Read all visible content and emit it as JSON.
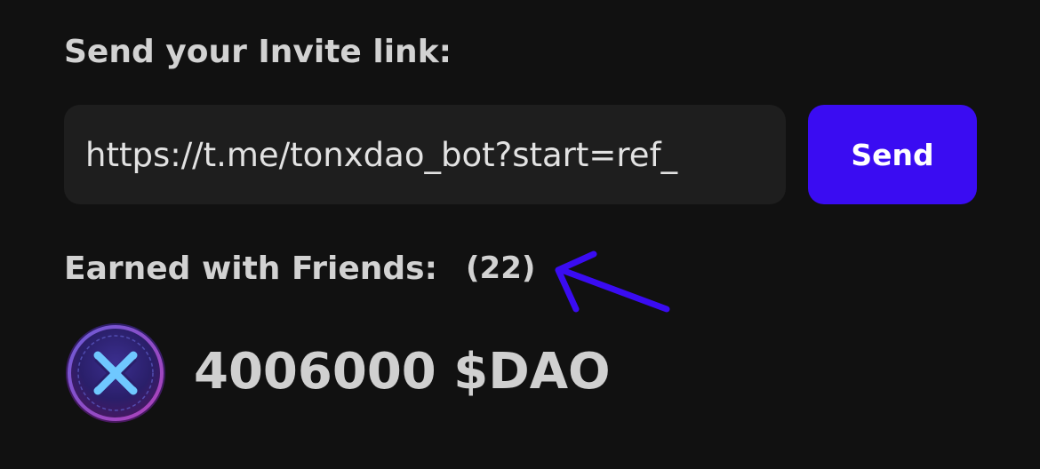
{
  "invite": {
    "heading": "Send your Invite link:",
    "link_value": "https://t.me/tonxdao_bot?start=ref_",
    "send_label": "Send"
  },
  "earned": {
    "heading": "Earned with Friends:",
    "count": "(22)",
    "balance": "4006000 $DAO",
    "token_icon": "tonxdao-logo-icon"
  },
  "annotation": {
    "icon": "arrow-annotation-icon",
    "color": "#3a0cf2"
  },
  "colors": {
    "background": "#111111",
    "field_background": "#1e1e1e",
    "accent": "#3a0cf2",
    "text": "#d2d2d2"
  }
}
